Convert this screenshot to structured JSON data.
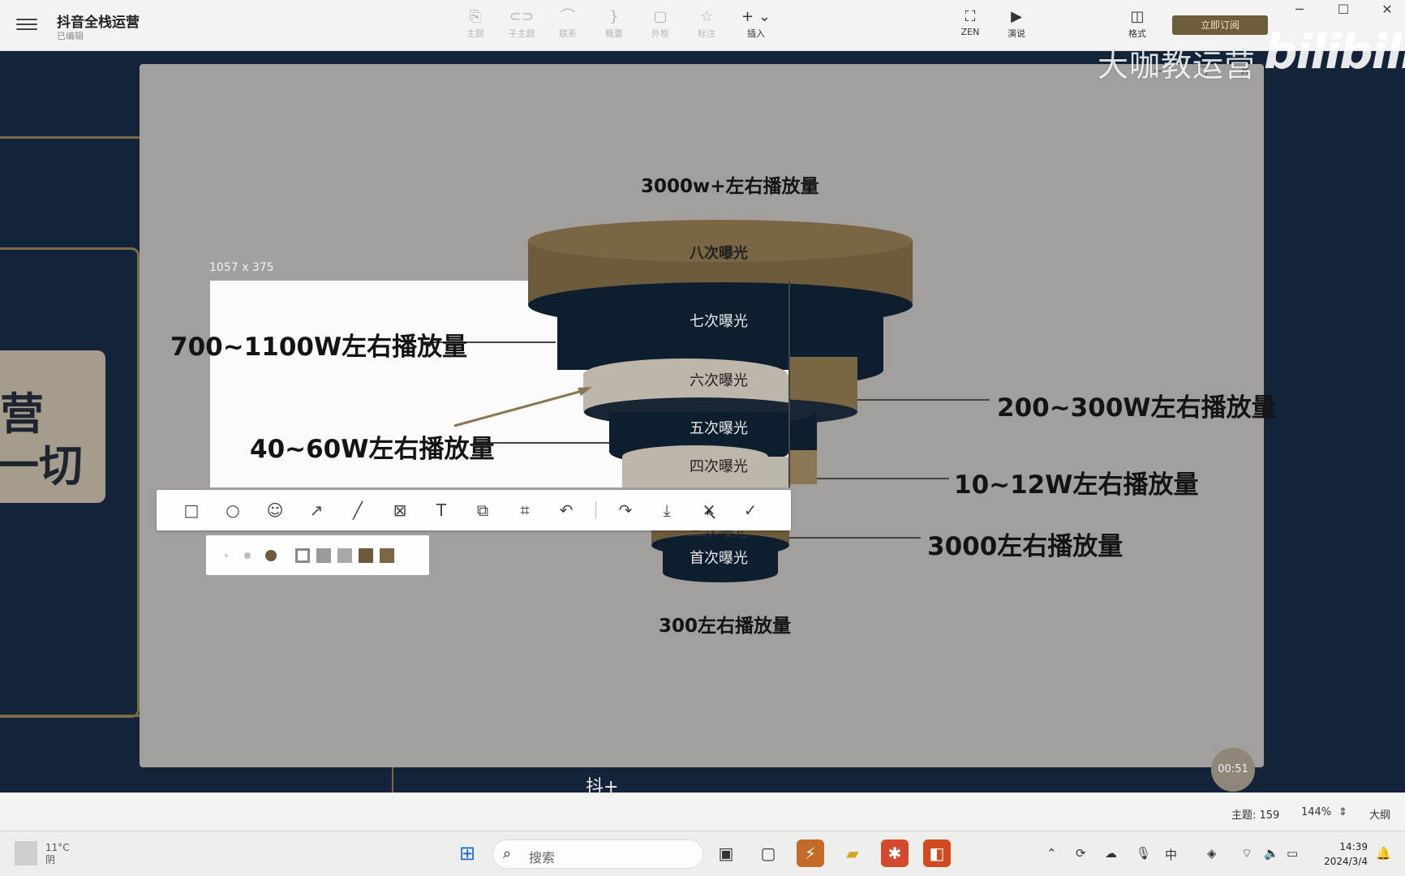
{
  "app": {
    "title": "抖音全栈运营",
    "subtitle": "已编辑",
    "toolbar": [
      {
        "label": "主题",
        "icon": "topic-icon"
      },
      {
        "label": "子主题",
        "icon": "subtopic-icon"
      },
      {
        "label": "联系",
        "icon": "relationship-icon"
      },
      {
        "label": "概要",
        "icon": "summary-icon"
      },
      {
        "label": "外框",
        "icon": "boundary-icon"
      },
      {
        "label": "标注",
        "icon": "marker-icon"
      },
      {
        "label": "插入",
        "icon": "insert-icon"
      },
      {
        "label": "ZEN",
        "icon": "zen-icon"
      },
      {
        "label": "演说",
        "icon": "pitch-icon"
      },
      {
        "label": "格式",
        "icon": "format-icon"
      }
    ],
    "subscribe_label": "立即订阅"
  },
  "watermark": {
    "text": "大咖教运营",
    "logo": "bilibili"
  },
  "canvas": {
    "node_line1": "营",
    "node_line2": "一切",
    "strip_text": "抖+"
  },
  "funnel": {
    "top_label": "3000w+左右播放量",
    "bottom_label": "300左右播放量",
    "layers": [
      "八次曝光",
      "七次曝光",
      "六次曝光",
      "五次曝光",
      "四次曝光",
      "三次曝光",
      "首次曝光"
    ],
    "left_labels": [
      "700~1100W左右播放量",
      "40~60W左右播放量"
    ],
    "right_labels": [
      "200~300W左右播放量",
      "10~12W左右播放量",
      "3000左右播放量"
    ],
    "colors": {
      "gold": "#6e5b3b",
      "navy": "#0f1e2e",
      "gray": "#a29f9c",
      "light": "#bdb6ab"
    }
  },
  "screenshot": {
    "size_text": "1057 x 375",
    "tools": [
      "rectangle-icon",
      "ellipse-icon",
      "emoji-icon",
      "arrow-icon",
      "line-icon",
      "mosaic-icon",
      "text-icon",
      "copy-icon",
      "ocr-icon",
      "undo-icon",
      "share-icon",
      "download-icon",
      "cancel-icon",
      "confirm-icon"
    ]
  },
  "timer": "00:51",
  "status": {
    "topics": "主题: 159",
    "zoom": "144%",
    "outline": "大纲"
  },
  "taskbar": {
    "weather_temp": "11°C",
    "weather_cond": "阴",
    "search_placeholder": "搜索",
    "time": "14:39",
    "date": "2024/3/4"
  }
}
